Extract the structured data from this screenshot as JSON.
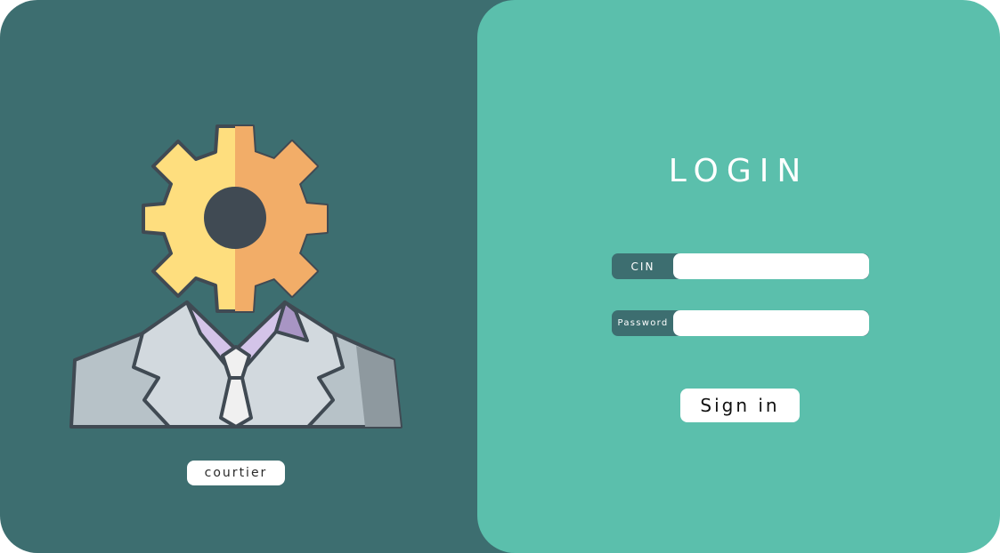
{
  "left_panel": {
    "illustration": "gear-headed-businessman-icon",
    "role_label": "courtier"
  },
  "login": {
    "title": "LOGIN",
    "fields": [
      {
        "label": "CIN",
        "value": ""
      },
      {
        "label": "Password",
        "value": ""
      }
    ],
    "sign_in_label": "Sign in"
  },
  "colors": {
    "left_panel_bg": "#3d6e70",
    "right_panel_bg": "#5bbfac",
    "gear_light": "#fede7e",
    "gear_dark": "#f2ad68",
    "collar": "#d4c4e9",
    "suit": "#b7c2c8",
    "outline": "#404a53"
  }
}
